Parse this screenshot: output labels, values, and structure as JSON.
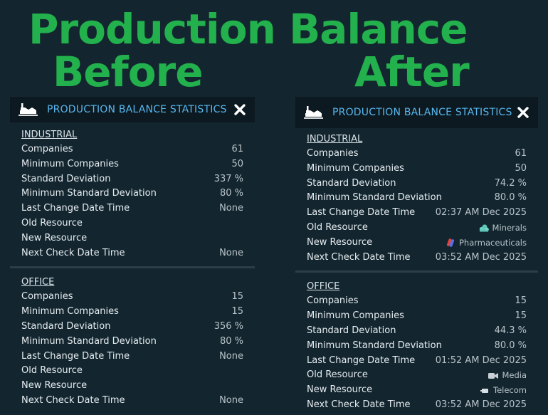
{
  "headline": {
    "main": "Production Balance",
    "before": "Before",
    "after": "After"
  },
  "before": {
    "title": "PRODUCTION BALANCE STATISTICS",
    "sections": {
      "industrial": {
        "title": "INDUSTRIAL",
        "rows": [
          {
            "label": "Companies",
            "value": "61"
          },
          {
            "label": "Minimum Companies",
            "value": "50"
          },
          {
            "label": "Standard Deviation",
            "value": "337 %"
          },
          {
            "label": "Minimum Standard Deviation",
            "value": "80 %"
          },
          {
            "label": "Last Change Date Time",
            "value": "None"
          },
          {
            "label": "Old Resource",
            "value": ""
          },
          {
            "label": "New Resource",
            "value": ""
          },
          {
            "label": "Next Check Date Time",
            "value": "None"
          }
        ]
      },
      "office": {
        "title": "OFFICE",
        "rows": [
          {
            "label": "Companies",
            "value": "15"
          },
          {
            "label": "Minimum Companies",
            "value": "15"
          },
          {
            "label": "Standard Deviation",
            "value": "356 %"
          },
          {
            "label": "Minimum Standard Deviation",
            "value": "80 %"
          },
          {
            "label": "Last Change Date Time",
            "value": "None"
          },
          {
            "label": "Old Resource",
            "value": ""
          },
          {
            "label": "New Resource",
            "value": ""
          },
          {
            "label": "Next Check Date Time",
            "value": "None"
          }
        ]
      }
    }
  },
  "after": {
    "title": "PRODUCTION BALANCE STATISTICS",
    "sections": {
      "industrial": {
        "title": "INDUSTRIAL",
        "rows": [
          {
            "label": "Companies",
            "value": "61"
          },
          {
            "label": "Minimum Companies",
            "value": "50"
          },
          {
            "label": "Standard Deviation",
            "value": "74.2 %"
          },
          {
            "label": "Minimum Standard Deviation",
            "value": "80.0 %"
          },
          {
            "label": "Last Change Date Time",
            "value": "02:37 AM Dec 2025"
          },
          {
            "label": "Old Resource",
            "value": "Minerals",
            "icon": "minerals-icon"
          },
          {
            "label": "New Resource",
            "value": "Pharmaceuticals",
            "icon": "pharmaceuticals-icon"
          },
          {
            "label": "Next Check Date Time",
            "value": "03:52 AM Dec 2025"
          }
        ]
      },
      "office": {
        "title": "OFFICE",
        "rows": [
          {
            "label": "Companies",
            "value": "15"
          },
          {
            "label": "Minimum Companies",
            "value": "15"
          },
          {
            "label": "Standard Deviation",
            "value": "44.3 %"
          },
          {
            "label": "Minimum Standard Deviation",
            "value": "80.0 %"
          },
          {
            "label": "Last Change Date Time",
            "value": "01:52 AM Dec 2025"
          },
          {
            "label": "Old Resource",
            "value": "Media",
            "icon": "media-icon"
          },
          {
            "label": "New Resource",
            "value": "Telecom",
            "icon": "telecom-icon"
          },
          {
            "label": "Next Check Date Time",
            "value": "03:52 AM Dec 2025"
          }
        ]
      }
    }
  },
  "colors": {
    "background": "#13262f",
    "header_bar": "#0c1920",
    "title_blue": "#58b7ee",
    "headline_green": "#22b14c",
    "divider": "#2c3e47"
  }
}
